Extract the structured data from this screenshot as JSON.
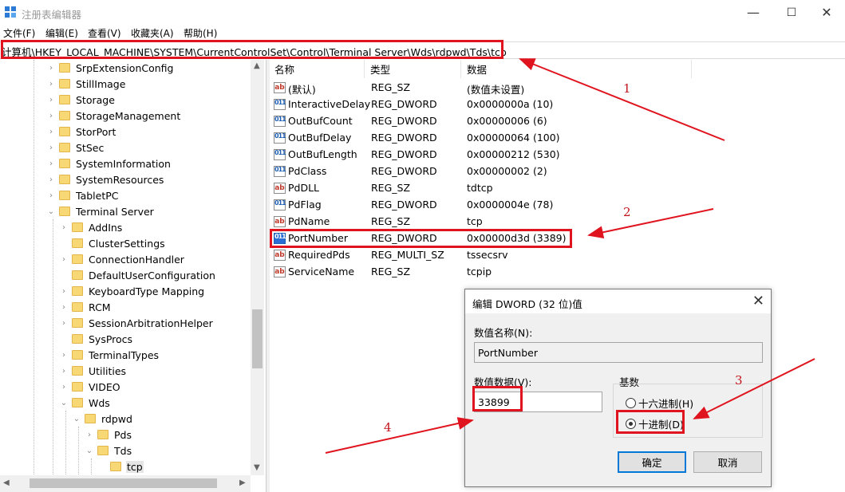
{
  "window": {
    "title": "注册表编辑器",
    "controls": {
      "minimize": "—",
      "maximize": "☐",
      "close": "✕"
    }
  },
  "menu": [
    "文件(F)",
    "编辑(E)",
    "查看(V)",
    "收藏夹(A)",
    "帮助(H)"
  ],
  "address": "计算机\\HKEY_LOCAL_MACHINE\\SYSTEM\\CurrentControlSet\\Control\\Terminal Server\\Wds\\rdpwd\\Tds\\tcp",
  "tree": [
    {
      "label": "SrpExtensionConfig",
      "expander": "›"
    },
    {
      "label": "StillImage",
      "expander": "›"
    },
    {
      "label": "Storage",
      "expander": "›"
    },
    {
      "label": "StorageManagement",
      "expander": "›"
    },
    {
      "label": "StorPort",
      "expander": "›"
    },
    {
      "label": "StSec",
      "expander": "›"
    },
    {
      "label": "SystemInformation",
      "expander": "›"
    },
    {
      "label": "SystemResources",
      "expander": "›"
    },
    {
      "label": "TabletPC",
      "expander": "›"
    },
    {
      "label": "Terminal Server",
      "expander": "⌄"
    },
    {
      "label": "AddIns",
      "expander": "›"
    },
    {
      "label": "ClusterSettings",
      "expander": ""
    },
    {
      "label": "ConnectionHandler",
      "expander": "›"
    },
    {
      "label": "DefaultUserConfiguration",
      "expander": ""
    },
    {
      "label": "KeyboardType Mapping",
      "expander": "›"
    },
    {
      "label": "RCM",
      "expander": "›"
    },
    {
      "label": "SessionArbitrationHelper",
      "expander": "›"
    },
    {
      "label": "SysProcs",
      "expander": ""
    },
    {
      "label": "TerminalTypes",
      "expander": "›"
    },
    {
      "label": "Utilities",
      "expander": "›"
    },
    {
      "label": "VIDEO",
      "expander": "›"
    },
    {
      "label": "Wds",
      "expander": "⌄"
    },
    {
      "label": "rdpwd",
      "expander": "⌄"
    },
    {
      "label": "Pds",
      "expander": "›"
    },
    {
      "label": "Tds",
      "expander": "⌄"
    },
    {
      "label": "tcp",
      "expander": ""
    }
  ],
  "columns": {
    "name": "名称",
    "type": "类型",
    "data": "数据"
  },
  "values": [
    {
      "icon": "ab",
      "name": "(默认)",
      "type": "REG_SZ",
      "data": "(数值未设置)"
    },
    {
      "icon": "011",
      "name": "InteractiveDelay",
      "type": "REG_DWORD",
      "data": "0x0000000a (10)"
    },
    {
      "icon": "011",
      "name": "OutBufCount",
      "type": "REG_DWORD",
      "data": "0x00000006 (6)"
    },
    {
      "icon": "011",
      "name": "OutBufDelay",
      "type": "REG_DWORD",
      "data": "0x00000064 (100)"
    },
    {
      "icon": "011",
      "name": "OutBufLength",
      "type": "REG_DWORD",
      "data": "0x00000212 (530)"
    },
    {
      "icon": "011",
      "name": "PdClass",
      "type": "REG_DWORD",
      "data": "0x00000002 (2)"
    },
    {
      "icon": "ab",
      "name": "PdDLL",
      "type": "REG_SZ",
      "data": "tdtcp"
    },
    {
      "icon": "011",
      "name": "PdFlag",
      "type": "REG_DWORD",
      "data": "0x0000004e (78)"
    },
    {
      "icon": "ab",
      "name": "PdName",
      "type": "REG_SZ",
      "data": "tcp"
    },
    {
      "icon": "011",
      "name": "PortNumber",
      "type": "REG_DWORD",
      "data": "0x00000d3d (3389)"
    },
    {
      "icon": "ab",
      "name": "RequiredPds",
      "type": "REG_MULTI_SZ",
      "data": "tssecsrv"
    },
    {
      "icon": "ab",
      "name": "ServiceName",
      "type": "REG_SZ",
      "data": "tcpip"
    }
  ],
  "dialog": {
    "title": "编辑 DWORD (32 位)值",
    "close": "✕",
    "value_name_label": "数值名称(N):",
    "value_name": "PortNumber",
    "value_data_label": "数值数据(V):",
    "value_data": "33899",
    "base_label": "基数",
    "hex_label": "十六进制(H)",
    "dec_label": "十进制(D)",
    "base_selected": "十进制(D)",
    "ok": "确定",
    "cancel": "取消"
  },
  "annotations": [
    "1",
    "2",
    "3",
    "4"
  ],
  "annotation_color": "#e0141e"
}
